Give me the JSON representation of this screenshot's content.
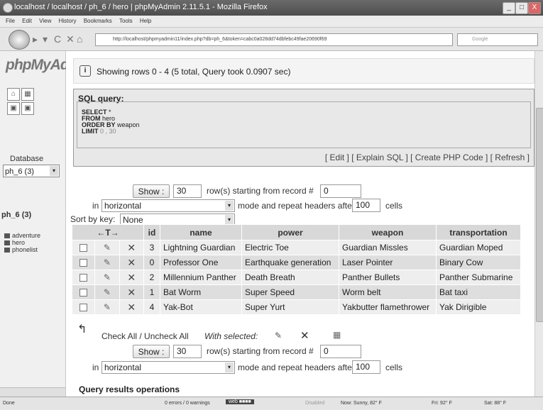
{
  "window": {
    "title": "localhost / localhost / ph_6 / hero | phpMyAdmin 2.11.5.1 - Mozilla Firefox",
    "minimize": "_",
    "restore": "□",
    "close": "X"
  },
  "menu": [
    "File",
    "Edit",
    "View",
    "History",
    "Bookmarks",
    "Tools",
    "Help"
  ],
  "nav": {
    "url": "http://localhost/phpmyadmin11/index.php?db=ph_6&token=cabc0a028dd74dbfebc49fae20690f69",
    "search_placeholder": "Google"
  },
  "sidebar": {
    "logo": "phpMyAdmin",
    "database_label": "Database",
    "database_value": "ph_6 (3)",
    "db_title": "ph_6 (3)",
    "tables": [
      "adventure",
      "hero",
      "phonelist"
    ]
  },
  "message": {
    "text": "Showing rows 0 - 4 (5 total, Query took 0.0907 sec)"
  },
  "sql": {
    "legend": "SQL query:",
    "kw_select": "SELECT",
    "select_rest": " *",
    "kw_from": "FROM",
    "from_rest": " hero",
    "kw_order": "ORDER BY",
    "order_rest": " weapon",
    "kw_limit": "LIMIT",
    "limit_rest": " 0 , 30",
    "links": "[ Edit ] [ Explain SQL ] [ Create PHP Code ] [ Refresh ]"
  },
  "nav_form": {
    "show_label": "Show :",
    "rows_value": "30",
    "rows_text": "row(s) starting from record #",
    "start_value": "0",
    "in_label": "in",
    "mode_value": "horizontal",
    "mode_text": "mode and repeat headers after",
    "repeat_value": "100",
    "cells_label": "cells"
  },
  "sort": {
    "label": "Sort by key:",
    "value": "None"
  },
  "table": {
    "arrows": "←T→",
    "headers": [
      "id",
      "name",
      "power",
      "weapon",
      "transportation"
    ],
    "rows": [
      [
        "3",
        "Lightning Guardian",
        "Electric Toe",
        "Guardian Missles",
        "Guardian Moped"
      ],
      [
        "0",
        "Professor One",
        "Earthquake generation",
        "Laser Pointer",
        "Binary Cow"
      ],
      [
        "2",
        "Millennium Panther",
        "Death Breath",
        "Panther Bullets",
        "Panther Submarine"
      ],
      [
        "1",
        "Bat Worm",
        "Super Speed",
        "Worm belt",
        "Bat taxi"
      ],
      [
        "4",
        "Yak-Bot",
        "Super Yurt",
        "Yakbutter flamethrower",
        "Yak Dirigible"
      ]
    ]
  },
  "with_selected": {
    "check_all": "Check All / Uncheck All",
    "with_selected": "With selected:"
  },
  "operations": {
    "legend": "Query results operations"
  },
  "status": {
    "done": "Done",
    "errors": "0 errors / 0 warnings",
    "disabled": "Disabled",
    "now": "Now: Sunny, 82° F",
    "fri": "Fri: 92° F",
    "sat": "Sat: 88° F"
  }
}
